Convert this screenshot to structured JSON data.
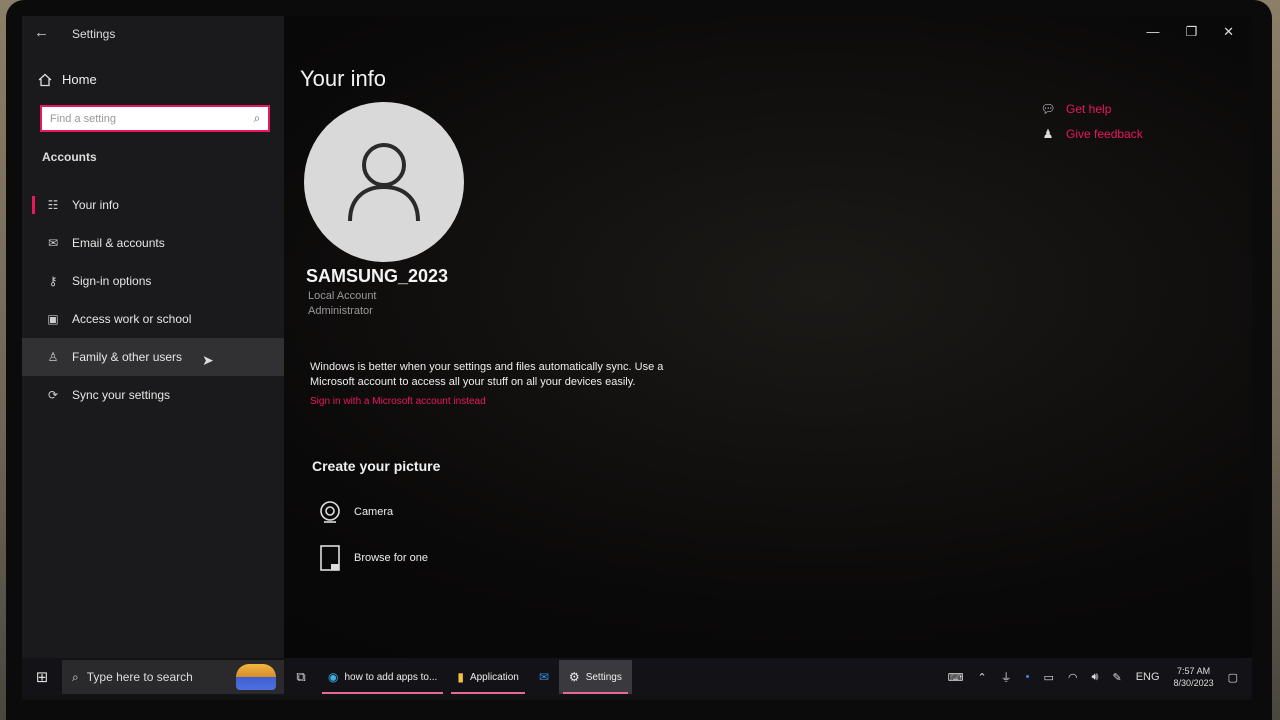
{
  "window": {
    "app_title": "Settings",
    "back_glyph": "←",
    "minimize_glyph": "—",
    "restore_glyph": "❐",
    "close_glyph": "✕"
  },
  "sidebar": {
    "home_label": "Home",
    "search_placeholder": "Find a setting",
    "section_label": "Accounts",
    "items": [
      {
        "label": "Your info",
        "icon": "person-card-icon",
        "glyph": "☷"
      },
      {
        "label": "Email & accounts",
        "icon": "mail-icon",
        "glyph": "✉"
      },
      {
        "label": "Sign-in options",
        "icon": "key-icon",
        "glyph": "⚷"
      },
      {
        "label": "Access work or school",
        "icon": "briefcase-icon",
        "glyph": "▣"
      },
      {
        "label": "Family & other users",
        "icon": "person-plus-icon",
        "glyph": "♙"
      },
      {
        "label": "Sync your settings",
        "icon": "sync-icon",
        "glyph": "⟳"
      }
    ]
  },
  "main": {
    "page_title": "Your info",
    "user_name": "SAMSUNG_2023",
    "account_type": "Local Account",
    "role": "Administrator",
    "sync_message": "Windows is better when your settings and files automatically sync. Use a Microsoft account to access all your stuff on all your devices easily.",
    "ms_link": "Sign in with a Microsoft account instead",
    "create_picture_title": "Create your picture",
    "camera_label": "Camera",
    "browse_label": "Browse for one",
    "get_help": "Get help",
    "give_feedback": "Give feedback"
  },
  "taskbar": {
    "search_placeholder": "Type here to search",
    "apps": [
      {
        "label": "how to add apps to...",
        "icon": "edge-icon"
      },
      {
        "label": "Application",
        "icon": "folder-icon"
      },
      {
        "label": "",
        "icon": "mail-app-icon"
      },
      {
        "label": "Settings",
        "icon": "settings-gear-icon"
      }
    ],
    "language": "ENG",
    "time": "7:57 AM",
    "date": "8/30/2023"
  },
  "colors": {
    "accent": "#e8195a",
    "sidebar_bg": "#1c1c1e",
    "taskbar_bg": "#141418"
  }
}
